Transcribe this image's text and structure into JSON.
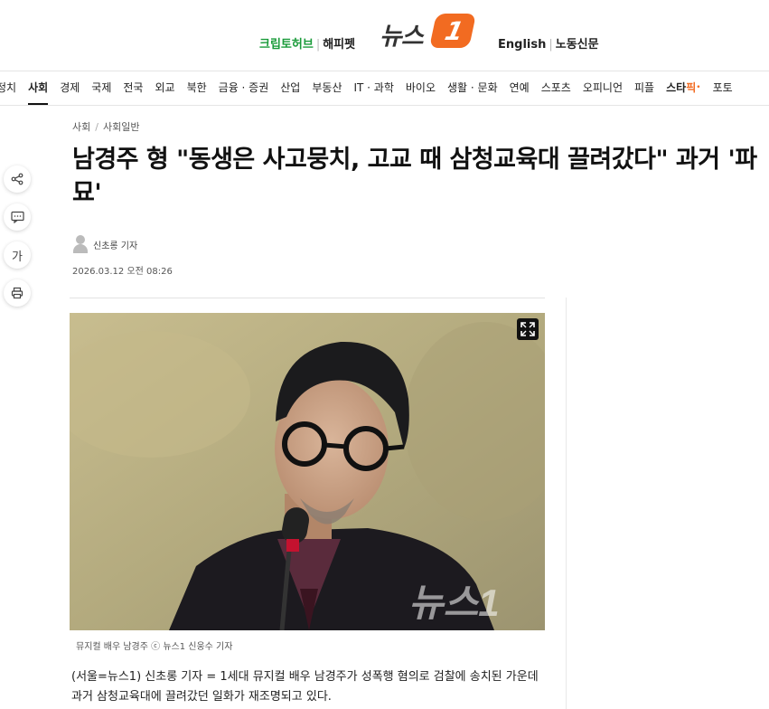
{
  "header": {
    "left_links": [
      "크립토허브",
      "해피펫"
    ],
    "logo_text": "뉴스",
    "logo_mark": "1",
    "right_links": [
      "English",
      "노동신문"
    ]
  },
  "nav": {
    "items": [
      "정치",
      "사회",
      "경제",
      "국제",
      "전국",
      "외교",
      "북한",
      "금융 · 증권",
      "산업",
      "부동산",
      "IT · 과학",
      "바이오",
      "생활 · 문화",
      "연예",
      "스포츠",
      "오피니언",
      "피플"
    ],
    "active": "사회",
    "special_star": "스타",
    "special_pick": "픽",
    "last": "포토"
  },
  "side_tools": {
    "font_label": "가"
  },
  "article": {
    "breadcrumb": [
      "사회",
      "사회일반"
    ],
    "title": "남경주 형 \"동생은 사고뭉치, 고교 때 삼청교육대 끌려갔다\" 과거 '파묘'",
    "author": "신초롱 기자",
    "date": "2026.03.12 오전 08:26",
    "photo_watermark": "뉴스1",
    "caption": "뮤지컬 배우 남경주 ⓒ 뉴스1 신웅수 기자",
    "body": "(서울=뉴스1) 신초롱 기자 = 1세대 뮤지컬 배우 남경주가 성폭행 혐의로 검찰에 송치된 가운데 과거 삼청교육대에 끌려갔던 일화가 재조명되고 있다."
  },
  "colors": {
    "accent_orange": "#f26b21",
    "crypto_green": "#1a9b3a"
  }
}
